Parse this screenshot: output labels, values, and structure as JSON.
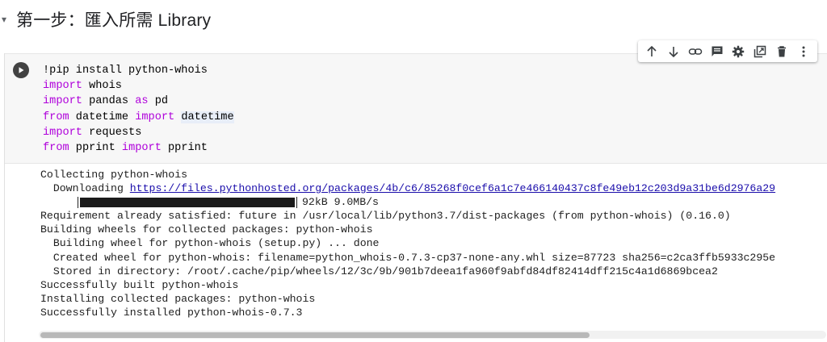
{
  "section": {
    "title": "第一步：匯入所需 Library"
  },
  "code_cell": {
    "lines": [
      [
        {
          "t": "!pip install python-whois",
          "c": ""
        }
      ],
      [
        {
          "t": "import",
          "c": "kw"
        },
        {
          "t": " whois",
          "c": ""
        }
      ],
      [
        {
          "t": "import",
          "c": "kw"
        },
        {
          "t": " pandas ",
          "c": ""
        },
        {
          "t": "as",
          "c": "kw"
        },
        {
          "t": " pd",
          "c": ""
        }
      ],
      [
        {
          "t": "from",
          "c": "kw"
        },
        {
          "t": " datetime ",
          "c": ""
        },
        {
          "t": "import",
          "c": "kw"
        },
        {
          "t": " ",
          "c": ""
        },
        {
          "t": "datetime",
          "c": "hl"
        }
      ],
      [
        {
          "t": "import",
          "c": "kw"
        },
        {
          "t": " requests",
          "c": ""
        }
      ],
      [
        {
          "t": "from",
          "c": "kw"
        },
        {
          "t": " pprint ",
          "c": ""
        },
        {
          "t": "import",
          "c": "kw"
        },
        {
          "t": " pprint",
          "c": ""
        }
      ]
    ]
  },
  "toolbar": {
    "buttons": [
      {
        "name": "move-up-icon"
      },
      {
        "name": "move-down-icon"
      },
      {
        "name": "link-icon"
      },
      {
        "name": "comment-icon"
      },
      {
        "name": "settings-icon"
      },
      {
        "name": "mirror-cell-icon"
      },
      {
        "name": "delete-icon"
      },
      {
        "name": "more-options-icon"
      }
    ]
  },
  "output": {
    "line1": "Collecting python-whois",
    "downloading_prefix": "  Downloading ",
    "download_url": "https://files.pythonhosted.org/packages/4b/c6/85268f0cef6a1c7e466140437c8fe49eb12c203d9a31be6d2976a29",
    "progress_fraction": 1.0,
    "progress_text": "92kB 9.0MB/s",
    "lines_after": [
      "Requirement already satisfied: future in /usr/local/lib/python3.7/dist-packages (from python-whois) (0.16.0)",
      "Building wheels for collected packages: python-whois",
      "  Building wheel for python-whois (setup.py) ... done",
      "  Created wheel for python-whois: filename=python_whois-0.7.3-cp37-none-any.whl size=87723 sha256=c2ca3ffb5933c295e",
      "  Stored in directory: /root/.cache/pip/wheels/12/3c/9b/901b7deea1fa960f9abfd84df82414dff215c4a1d6869bcea2",
      "Successfully built python-whois",
      "Installing collected packages: python-whois",
      "Successfully installed python-whois-0.7.3"
    ]
  },
  "scrollbar": {
    "thumb_fraction": 0.7
  }
}
